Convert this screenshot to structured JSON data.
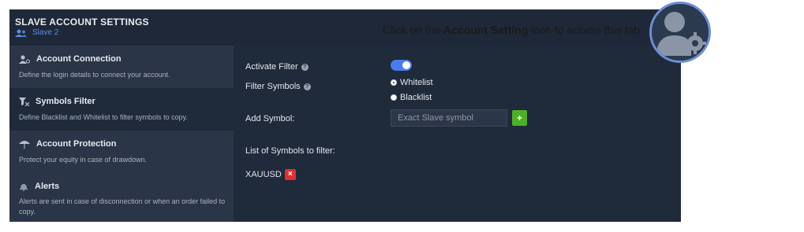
{
  "header": {
    "title": "SLAVE ACCOUNT SETTINGS",
    "account_name": "Slave 2"
  },
  "sidebar": {
    "items": [
      {
        "label": "Account Connection",
        "desc": "Define the login details to connect your account.",
        "icon": "user-connect-icon"
      },
      {
        "label": "Symbols Filter",
        "desc": "Define Blacklist and Whitelist to filter symbols to copy.",
        "icon": "filter-icon"
      },
      {
        "label": "Account Protection",
        "desc": "Protect your equity in case of drawdown.",
        "icon": "umbrella-icon"
      },
      {
        "label": "Alerts",
        "desc": "Alerts are sent in case of disconnection or when an order failed to copy.",
        "icon": "bell-icon"
      }
    ],
    "active_index": 1
  },
  "filter": {
    "activate_label": "Activate Filter",
    "activate_on": true,
    "symbols_label": "Filter Symbols",
    "options": [
      "Whitelist",
      "Blacklist"
    ],
    "selected_option": "Whitelist",
    "add_label": "Add Symbol:",
    "input_placeholder": "Exact Slave symbol",
    "add_button": "+",
    "list_label": "List of Symbols to filter:",
    "symbols": [
      "XAUUSD"
    ],
    "remove_button": "×"
  },
  "callout": {
    "prefix": "Click on the ",
    "highlight": "Account Setting",
    "suffix": " icon to access this tab"
  },
  "colors": {
    "panel": "#1f2a3a",
    "sidebar": "#2a3547",
    "accent": "#4a7cf0",
    "add": "#4fae27",
    "remove": "#e03030"
  }
}
